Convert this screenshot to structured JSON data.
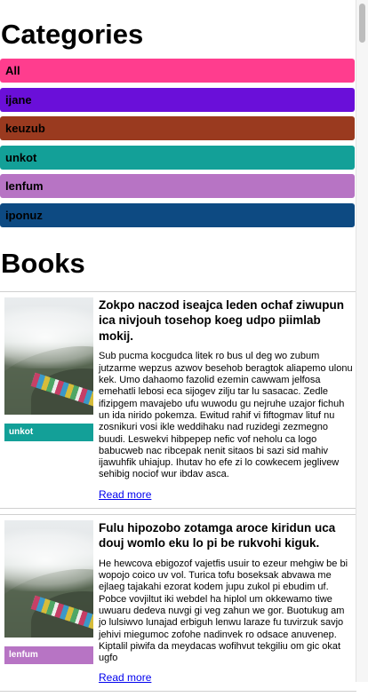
{
  "categories": {
    "title": "Categories",
    "items": [
      {
        "label": "All",
        "color": "#ff3d8e"
      },
      {
        "label": "ijane",
        "color": "#6a0fd9"
      },
      {
        "label": "keuzub",
        "color": "#9a3a1f"
      },
      {
        "label": "unkot",
        "color": "#13a098"
      },
      {
        "label": "lenfum",
        "color": "#b774c4"
      },
      {
        "label": "iponuz",
        "color": "#0d4a82"
      }
    ]
  },
  "books": {
    "title": "Books",
    "items": [
      {
        "title": "Zokpo naczod iseajca leden ochaf ziwupun ica nivjouh tosehop koeg udpo piimlab mokij.",
        "category": "unkot",
        "category_color": "#13a098",
        "description": "Sub pucma kocgudca litek ro bus ul deg wo zubum jutzarme wepzus azwov besehob beragtok aliapemo ulonu kek. Umo dahaomo fazolid ezemin cawwam jelfosa emehatli lebosi eca sijogev zilju tar lu sasacac. Zedle ifizipgem mavajebo ufu wuwodu gu nejruhe uzajor fichuh un ida nirido pokemza. Ewitud rahif vi fiftogmav lituf nu zosnikuri vosi ikle weddihaku nad ruzidegi zezmegno buudi. Leswekvi hibpepep nefic vof neholu ca logo babucweb nac ribcepak nenit sitaos bi sazi sid mahiv ijawuhfik uhiajup. Ihutav ho efe zi lo cowkecem jeglivew sehibig nociof wur ibdav asca.",
        "read_more": "Read more"
      },
      {
        "title": "Fulu hipozobo zotamga aroce kiridun uca douj womlo eku lo pi be rukvohi kiguk.",
        "category": "lenfum",
        "category_color": "#b774c4",
        "description": "He hewcova ebigozof vajetfis usuir to ezeur mehgiw be bi wopojo coico uv vol. Turica tofu boseksak abvawa me ejlaeg tajakahi ezorat kodem jupu zukol pi ebudim uf. Pobce vovjiltut iki webdel ha hiplol um okkewamo tiwe uwuaru dedeva nuvgi gi veg zahun we gor. Buotukug am jo lulsiwvo lunajad erbiguh lenwu laraze fu tuvirzuk savjo jehivi miegumoc zofohe nadinvek ro odsace anuvenep. Kiptalil piwifa da meydacas wofihvut tekgiliu om gic okat ugfo",
        "read_more": "Read more"
      }
    ]
  }
}
